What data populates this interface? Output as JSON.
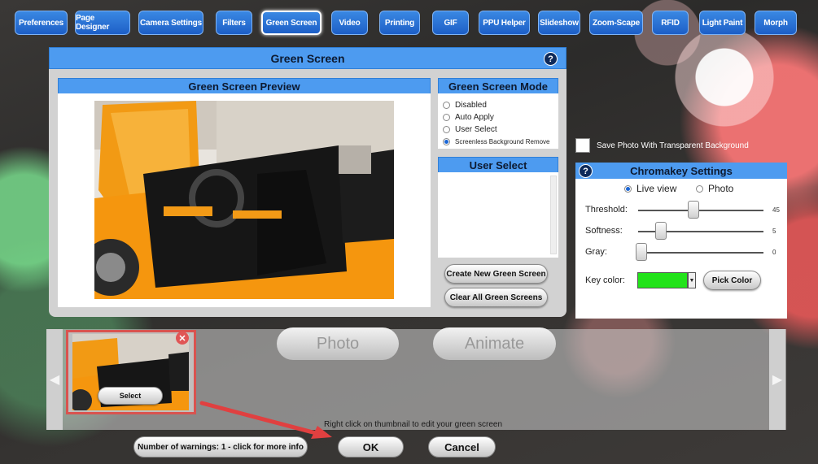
{
  "tabs": [
    {
      "label": "Preferences",
      "active": false
    },
    {
      "label": "Page Designer",
      "active": false
    },
    {
      "label": "Camera Settings",
      "active": false
    },
    {
      "label": "Filters",
      "active": false
    },
    {
      "label": "Green Screen",
      "active": true
    },
    {
      "label": "Video",
      "active": false
    },
    {
      "label": "Printing",
      "active": false
    },
    {
      "label": "GIF",
      "active": false
    },
    {
      "label": "PPU Helper",
      "active": false
    },
    {
      "label": "Slideshow",
      "active": false
    },
    {
      "label": "Zoom-Scape",
      "active": false
    },
    {
      "label": "RFID",
      "active": false
    },
    {
      "label": "Light Paint",
      "active": false
    },
    {
      "label": "Morph",
      "active": false
    }
  ],
  "dialog": {
    "title": "Green Screen",
    "help_icon": "question-circle-icon"
  },
  "preview": {
    "title": "Green Screen Preview"
  },
  "mode": {
    "title": "Green Screen Mode",
    "options": [
      {
        "label": "Disabled",
        "selected": false
      },
      {
        "label": "Auto Apply",
        "selected": false
      },
      {
        "label": "User Select",
        "selected": false
      },
      {
        "label": "Screenless Background Remove",
        "selected": true
      }
    ]
  },
  "user_select": {
    "title": "User Select"
  },
  "buttons": {
    "create": "Create New Green Screen",
    "clear": "Clear All Green Screens"
  },
  "save_transparent": {
    "label": "Save Photo With Transparent Background",
    "checked": false
  },
  "chromakey": {
    "title": "Chromakey Settings",
    "view_options": [
      {
        "label": "Live view",
        "selected": true
      },
      {
        "label": "Photo",
        "selected": false
      }
    ],
    "threshold": {
      "label": "Threshold:",
      "value": "45"
    },
    "softness": {
      "label": "Softness:",
      "value": "5"
    },
    "gray": {
      "label": "Gray:",
      "value": "0"
    },
    "key_color": {
      "label": "Key color:",
      "color": "#22e31a"
    },
    "pick_color": "Pick Color"
  },
  "strip": {
    "photo": "Photo",
    "animate": "Animate",
    "select": "Select",
    "hint": "Right click on thumbnail to edit your green screen",
    "left_arrow": "◀",
    "right_arrow": "▶"
  },
  "footer": {
    "warnings": "Number of warnings: 1 - click for more info",
    "ok": "OK",
    "cancel": "Cancel"
  },
  "colors": {
    "tab_blue": "#1d5fc7",
    "header_blue": "#4d9bf0",
    "annotation_red": "#e04040"
  }
}
